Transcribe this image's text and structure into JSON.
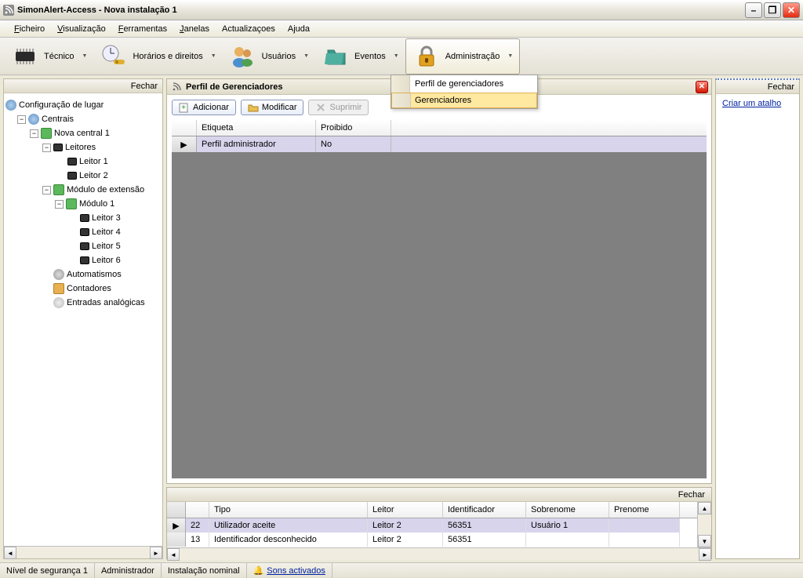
{
  "titlebar": {
    "title": "SimonAlert-Access - Nova instalação 1"
  },
  "menubar": {
    "ficheiro": "Ficheiro",
    "visualizacao": "Visualização",
    "ferramentas": "Ferramentas",
    "janelas": "Janelas",
    "actualizacoes": "Actualizaçoes",
    "ajuda": "Ajuda"
  },
  "toolbar": {
    "tecnico": "Técnico",
    "horarios": "Horários e direitos",
    "usuarios": "Usuários",
    "eventos": "Eventos",
    "administracao": "Administração"
  },
  "dropdown": {
    "item1": "Perfil de gerenciadores",
    "item2": "Gerenciadores"
  },
  "left": {
    "close": "Fechar",
    "root": "Configuração de lugar",
    "centrais": "Centrais",
    "nova_central": "Nova central 1",
    "leitores": "Leitores",
    "leitor1": "Leitor 1",
    "leitor2": "Leitor 2",
    "modulo_ext": "Módulo de extensão",
    "modulo1": "Módulo 1",
    "leitor3": "Leitor 3",
    "leitor4": "Leitor 4",
    "leitor5": "Leitor 5",
    "leitor6": "Leitor 6",
    "automatismos": "Automatismos",
    "contadores": "Contadores",
    "entradas": "Entradas analógicas"
  },
  "center": {
    "title": "Perfil de Gerenciadores",
    "adicionar": "Adicionar",
    "modificar": "Modificar",
    "suprimir": "Suprimir",
    "col_etiqueta": "Etiqueta",
    "col_proibido": "Proibido",
    "row1_etiqueta": "Perfil administrador",
    "row1_proibido": "No"
  },
  "bottom": {
    "close": "Fechar",
    "col_tipo": "Tipo",
    "col_leitor": "Leitor",
    "col_identificador": "Identificador",
    "col_sobrenome": "Sobrenome",
    "col_prenome": "Prenome",
    "r1_num": "22",
    "r1_tipo": "Utilizador aceite",
    "r1_leitor": "Leitor 2",
    "r1_id": "56351",
    "r1_sobrenome": "Usuário 1",
    "r2_num": "13",
    "r2_tipo": "Identificador desconhecido",
    "r2_leitor": "Leitor 2",
    "r2_id": "56351"
  },
  "right": {
    "close": "Fechar",
    "link": "Criar um atalho"
  },
  "status": {
    "nivel": "Nível de segurança 1",
    "admin": "Administrador",
    "instalacao": "Instalação nominal",
    "sons": "Sons activados"
  }
}
